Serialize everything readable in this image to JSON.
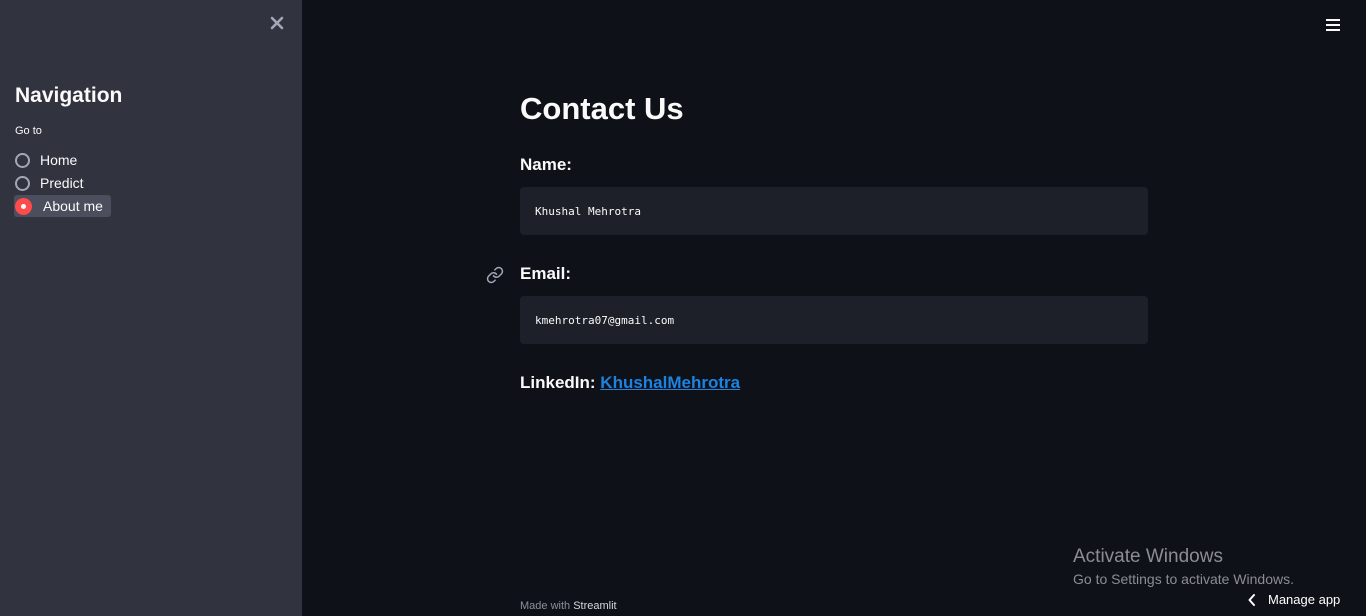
{
  "sidebar": {
    "close_icon": "close-icon",
    "title": "Navigation",
    "goto_label": "Go to",
    "options": [
      {
        "label": "Home",
        "selected": false
      },
      {
        "label": "Predict",
        "selected": false
      },
      {
        "label": "About me",
        "selected": true
      }
    ]
  },
  "header": {
    "menu_icon": "hamburger-menu-icon"
  },
  "main": {
    "title": "Contact Us",
    "name_label": "Name:",
    "name_value": "Khushal Mehrotra",
    "email_label": "Email:",
    "email_value": "kmehrotra07@gmail.com",
    "linkedin_label": "LinkedIn:",
    "linkedin_link_text": "KhushalMehrotra"
  },
  "footer": {
    "made_with": "Made with",
    "brand": "Streamlit"
  },
  "watermark": {
    "title": "Activate Windows",
    "subtitle": "Go to Settings to activate Windows."
  },
  "manage_app": {
    "label": "Manage app"
  },
  "colors": {
    "sidebar_bg": "#31333f",
    "main_bg": "#0e1117",
    "accent": "#ff4b4b",
    "link": "#1c83e1",
    "code_bg": "#1e2029"
  }
}
